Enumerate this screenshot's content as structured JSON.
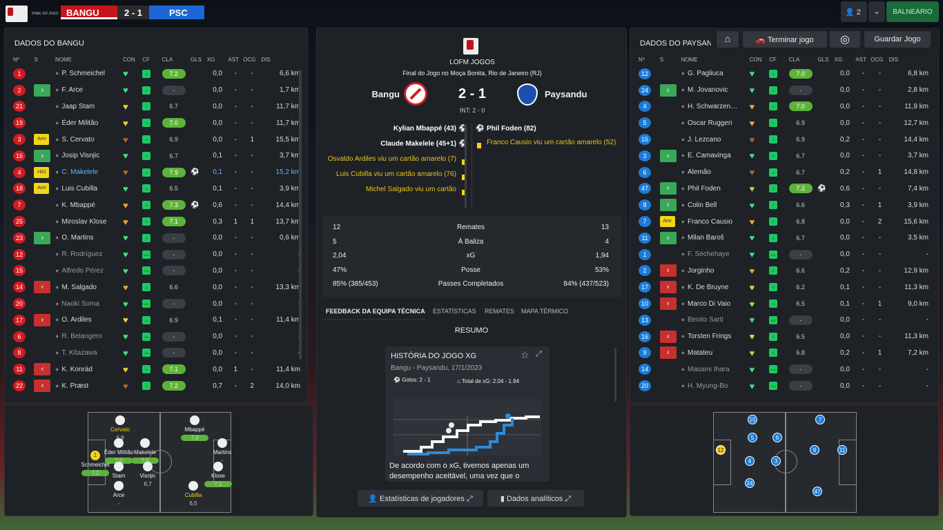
{
  "topbar": {
    "competition": "FINAL DO JOGO",
    "home": "BANGU",
    "score": "2 - 1",
    "away": "PSC",
    "users": "👤 2",
    "chevron": "⌄",
    "balneario": "BALNEÁRIO"
  },
  "actions": {
    "home_icon": "⌂",
    "end_game": "Terminar jogo",
    "end_icon": "🚗",
    "record_icon": "◎",
    "save": "Guardar Jogo"
  },
  "left": {
    "title": "DADOS DO BANGU",
    "headers": [
      "Nº",
      "S",
      "NOME",
      "CON",
      "CF",
      "CLA",
      "GLS",
      "XG",
      "AST",
      "OCG",
      "DIS"
    ],
    "players": [
      {
        "n": "1",
        "s": "",
        "name": "P. Schmeichel",
        "con": "g",
        "cla": "7.2",
        "gls": "",
        "xg": "0,0",
        "ast": "-",
        "ocg": "-",
        "dis": "6,6 km"
      },
      {
        "n": "2",
        "s": "in",
        "name": "F. Arce",
        "con": "g",
        "cla": "-",
        "gls": "",
        "xg": "0,0",
        "ast": "-",
        "ocg": "-",
        "dis": "1,7 km"
      },
      {
        "n": "21",
        "s": "",
        "name": "Jaap Stam",
        "con": "y",
        "cla": "6.7",
        "gls": "",
        "xg": "0,0",
        "ast": "-",
        "ocg": "-",
        "dis": "11,7 km"
      },
      {
        "n": "19",
        "s": "",
        "name": "Éder Militão",
        "con": "y",
        "cla": "7.0",
        "gls": "",
        "xg": "0,0",
        "ast": "-",
        "ocg": "-",
        "dis": "11,7 km"
      },
      {
        "n": "3",
        "s": "Amr",
        "name": "S. Cervato",
        "con": "b",
        "cla": "6.9",
        "gls": "",
        "xg": "0,0",
        "ast": "-",
        "ocg": "1",
        "dis": "15,5 km"
      },
      {
        "n": "16",
        "s": "in",
        "name": "Josip Visnjic",
        "con": "g",
        "cla": "6.7",
        "gls": "",
        "xg": "0,1",
        "ast": "-",
        "ocg": "-",
        "dis": "3,7 km"
      },
      {
        "n": "4",
        "s": "HdJ",
        "name": "C. Makelele",
        "con": "b",
        "cla": "7.9",
        "gls": "⚽",
        "xg": "0,1",
        "ast": "-",
        "ocg": "-",
        "dis": "15,2 km",
        "hl": true
      },
      {
        "n": "18",
        "s": "Amr",
        "name": "Luis Cubilla",
        "con": "g",
        "cla": "6.5",
        "gls": "",
        "xg": "0,1",
        "ast": "-",
        "ocg": "-",
        "dis": "3,9 km"
      },
      {
        "n": "7",
        "s": "",
        "name": "K. Mbappé",
        "con": "o",
        "cla": "7.3",
        "gls": "⚽",
        "xg": "0,6",
        "ast": "-",
        "ocg": "-",
        "dis": "14,4 km"
      },
      {
        "n": "25",
        "s": "",
        "name": "Miroslav Klose",
        "con": "o",
        "cla": "7.1",
        "gls": "",
        "xg": "0,3",
        "ast": "1",
        "ocg": "1",
        "dis": "13,7 km"
      },
      {
        "n": "23",
        "s": "in",
        "name": "O. Martins",
        "con": "g",
        "cla": "-",
        "gls": "",
        "xg": "0,0",
        "ast": "-",
        "ocg": "-",
        "dis": "0,6 km"
      },
      {
        "n": "12",
        "s": "",
        "name": "R. Rodríguez",
        "con": "g",
        "cla": "-",
        "gls": "",
        "xg": "0,0",
        "ast": "-",
        "ocg": "-",
        "dis": "-",
        "dim": true
      },
      {
        "n": "15",
        "s": "",
        "name": "Alfredo Pérez",
        "con": "g",
        "cla": "-",
        "gls": "",
        "xg": "0,0",
        "ast": "-",
        "ocg": "-",
        "dis": "-",
        "dim": true
      },
      {
        "n": "14",
        "s": "out",
        "name": "M. Salgado",
        "con": "o",
        "cla": "6.6",
        "gls": "",
        "xg": "0,0",
        "ast": "-",
        "ocg": "-",
        "dis": "13,3 km"
      },
      {
        "n": "20",
        "s": "",
        "name": "Naoki Soma",
        "con": "g",
        "cla": "-",
        "gls": "",
        "xg": "0,0",
        "ast": "-",
        "ocg": "-",
        "dis": "-",
        "dim": true
      },
      {
        "n": "17",
        "s": "out",
        "name": "O. Ardiles",
        "con": "y",
        "cla": "6.9",
        "gls": "",
        "xg": "0,1",
        "ast": "-",
        "ocg": "-",
        "dis": "11,4 km"
      },
      {
        "n": "6",
        "s": "",
        "name": "R. Belangero",
        "con": "g",
        "cla": "-",
        "gls": "",
        "xg": "0,0",
        "ast": "-",
        "ocg": "-",
        "dis": "-",
        "dim": true
      },
      {
        "n": "8",
        "s": "",
        "name": "T. Kitazawa",
        "con": "g",
        "cla": "-",
        "gls": "",
        "xg": "0,0",
        "ast": "-",
        "ocg": "-",
        "dis": "-",
        "dim": true
      },
      {
        "n": "11",
        "s": "out",
        "name": "K. Konrád",
        "con": "y",
        "cla": "7.1",
        "gls": "",
        "xg": "0,0",
        "ast": "1",
        "ocg": "-",
        "dis": "11,4 km"
      },
      {
        "n": "22",
        "s": "out",
        "name": "K. Præst",
        "con": "b",
        "cla": "7.2",
        "gls": "",
        "xg": "0,7",
        "ast": "-",
        "ocg": "2",
        "dis": "14,0 km"
      }
    ],
    "pitch": [
      {
        "name": "Cervato",
        "rate": "6,9",
        "ny": true
      },
      {
        "name": "Mbappé",
        "rate": "7,3",
        "r": true
      },
      {
        "name": "Éder Militão",
        "rate": "7,0",
        "r": true
      },
      {
        "name": "Makelele",
        "rate": "7,9",
        "r": true
      },
      {
        "name": "Schmeichel",
        "rate": "7,2",
        "r": true,
        "num": "1"
      },
      {
        "name": "Stam",
        "rate": "6,7"
      },
      {
        "name": "Visnjic",
        "rate": "6,7"
      },
      {
        "name": "Martins",
        "rate": "-"
      },
      {
        "name": "Klose",
        "rate": "7,1",
        "r": true
      },
      {
        "name": "Arce",
        "rate": "-"
      },
      {
        "name": "Cubilla",
        "rate": "6,5",
        "ny": true
      }
    ]
  },
  "center": {
    "league": "LOFM JOGOS",
    "venue": "Final do Jogo no Moça Bonita, Rio de Janeiro (RJ)",
    "home": "Bangu",
    "score": "2 - 1",
    "away": "Paysandu",
    "ht": "INT: 2 - 0",
    "home_events": [
      {
        "text": "Kylian Mbappé (43)",
        "type": "goal"
      },
      {
        "text": "Claude Makelele (45+1)",
        "type": "goal"
      },
      {
        "text": "Osvaldo Ardiles viu um cartão amarelo (7)",
        "type": "card"
      },
      {
        "text": "Luis Cubilla viu um cartão amarelo (76)",
        "type": "card"
      },
      {
        "text": "Michel Salgado viu um cartão",
        "type": "card"
      }
    ],
    "away_events": [
      {
        "text": "Phil Foden (82)",
        "type": "goal"
      },
      {
        "text": "Franco Causio viu um cartão amarelo (52)",
        "type": "card"
      }
    ],
    "stats": [
      {
        "l": "12",
        "c": "Remates",
        "r": "13"
      },
      {
        "l": "5",
        "c": "À Baliza",
        "r": "4"
      },
      {
        "l": "2,04",
        "c": "xG",
        "r": "1,94"
      },
      {
        "l": "47%",
        "c": "Posse",
        "r": "53%"
      },
      {
        "l": "85% (385/453)",
        "c": "Passes Completados",
        "r": "84% (437/523)"
      }
    ],
    "tabs": [
      "FEEDBACK DA EQUIPA TÉCNICA",
      "ESTATÍSTICAS",
      "REMATES",
      "MAPA TÉRMICO"
    ],
    "resumo": "RESUMO",
    "card": {
      "title": "HISTÓRIA DO JOGO XG",
      "sub": "Bangu - Paysandu, 17/1/2023",
      "goals": "Golos: 2 - 1",
      "total": "Total de xG: 2.04 - 1.94",
      "text": "De acordo com o xG, tivemos apenas um desempenho aceitável, uma vez que o"
    },
    "btn_players": "Estatísticas de jogadores",
    "btn_data": "Dados analíticos"
  },
  "right": {
    "title": "DADOS DO PAYSANDU",
    "headers": [
      "Nº",
      "S",
      "NOME",
      "CON",
      "CF",
      "CLA",
      "GLS",
      "XG",
      "AST",
      "OCG",
      "DIS"
    ],
    "players": [
      {
        "n": "12",
        "s": "",
        "name": "G. Pagliuca",
        "con": "g",
        "cla": "7.0",
        "gls": "",
        "xg": "0,0",
        "ast": "-",
        "ocg": "-",
        "dis": "6,8 km"
      },
      {
        "n": "24",
        "s": "in",
        "name": "M. Jovanovic",
        "con": "g",
        "cla": "-",
        "gls": "",
        "xg": "0,0",
        "ast": "-",
        "ocg": "-",
        "dis": "2,8 km"
      },
      {
        "n": "4",
        "s": "",
        "name": "H. Schwarzen…",
        "con": "o",
        "cla": "7.0",
        "gls": "",
        "xg": "0,0",
        "ast": "-",
        "ocg": "-",
        "dis": "11,9 km"
      },
      {
        "n": "5",
        "s": "",
        "name": "Oscar Ruggeri",
        "con": "o",
        "cla": "6.9",
        "gls": "",
        "xg": "0,0",
        "ast": "-",
        "ocg": "-",
        "dis": "12,7 km"
      },
      {
        "n": "15",
        "s": "",
        "name": "J. Lezcano",
        "con": "b",
        "cla": "6.9",
        "gls": "",
        "xg": "0,2",
        "ast": "-",
        "ocg": "-",
        "dis": "14,4 km"
      },
      {
        "n": "3",
        "s": "in",
        "name": "E. Camavinga",
        "con": "g",
        "cla": "6.7",
        "gls": "",
        "xg": "0,0",
        "ast": "-",
        "ocg": "-",
        "dis": "3,7 km"
      },
      {
        "n": "6",
        "s": "",
        "name": "Alemão",
        "con": "b",
        "cla": "6.7",
        "gls": "",
        "xg": "0,2",
        "ast": "-",
        "ocg": "1",
        "dis": "14,8 km"
      },
      {
        "n": "47",
        "s": "in",
        "name": "Phil Foden",
        "con": "l",
        "cla": "7.2",
        "gls": "⚽",
        "xg": "0,6",
        "ast": "-",
        "ocg": "-",
        "dis": "7,4 km"
      },
      {
        "n": "8",
        "s": "in",
        "name": "Colin Bell",
        "con": "g",
        "cla": "6.6",
        "gls": "",
        "xg": "0,3",
        "ast": "-",
        "ocg": "1",
        "dis": "3,9 km"
      },
      {
        "n": "7",
        "s": "Amr",
        "name": "Franco Causio",
        "con": "o",
        "cla": "6.8",
        "gls": "",
        "xg": "0,0",
        "ast": "-",
        "ocg": "2",
        "dis": "15,6 km"
      },
      {
        "n": "11",
        "s": "in",
        "name": "Milan Baroš",
        "con": "g",
        "cla": "6.7",
        "gls": "",
        "xg": "0,0",
        "ast": "-",
        "ocg": "-",
        "dis": "3,5 km"
      },
      {
        "n": "1",
        "s": "",
        "name": "F. Séchehaye",
        "con": "g",
        "cla": "-",
        "gls": "",
        "xg": "0,0",
        "ast": "-",
        "ocg": "-",
        "dis": "-",
        "dim": true
      },
      {
        "n": "2",
        "s": "out",
        "name": "Jorginho",
        "con": "o",
        "cla": "6.6",
        "gls": "",
        "xg": "0,2",
        "ast": "-",
        "ocg": "-",
        "dis": "12,9 km"
      },
      {
        "n": "17",
        "s": "out",
        "name": "K. De Bruyne",
        "con": "y",
        "cla": "6.2",
        "gls": "",
        "xg": "0,1",
        "ast": "-",
        "ocg": "-",
        "dis": "11,3 km"
      },
      {
        "n": "10",
        "s": "out",
        "name": "Marco Di Vaio",
        "con": "l",
        "cla": "6.5",
        "gls": "",
        "xg": "0,1",
        "ast": "-",
        "ocg": "1",
        "dis": "9,0 km"
      },
      {
        "n": "13",
        "s": "",
        "name": "Benito Sarti",
        "con": "g",
        "cla": "-",
        "gls": "",
        "xg": "0,0",
        "ast": "-",
        "ocg": "-",
        "dis": "-",
        "dim": true
      },
      {
        "n": "16",
        "s": "out",
        "name": "Torsten Frings",
        "con": "y",
        "cla": "6.5",
        "gls": "",
        "xg": "0,0",
        "ast": "-",
        "ocg": "-",
        "dis": "11,3 km"
      },
      {
        "n": "9",
        "s": "out",
        "name": "Matateu",
        "con": "l",
        "cla": "6.8",
        "gls": "",
        "xg": "0,2",
        "ast": "-",
        "ocg": "1",
        "dis": "7,2 km"
      },
      {
        "n": "14",
        "s": "",
        "name": "Masami Ihara",
        "con": "g",
        "cla": "-",
        "gls": "",
        "xg": "0,0",
        "ast": "-",
        "ocg": "-",
        "dis": "-",
        "dim": true
      },
      {
        "n": "20",
        "s": "",
        "name": "H. Myung-Bo",
        "con": "g",
        "cla": "-",
        "gls": "",
        "xg": "0,0",
        "ast": "-",
        "ocg": "-",
        "dis": "-",
        "dim": true
      }
    ]
  }
}
